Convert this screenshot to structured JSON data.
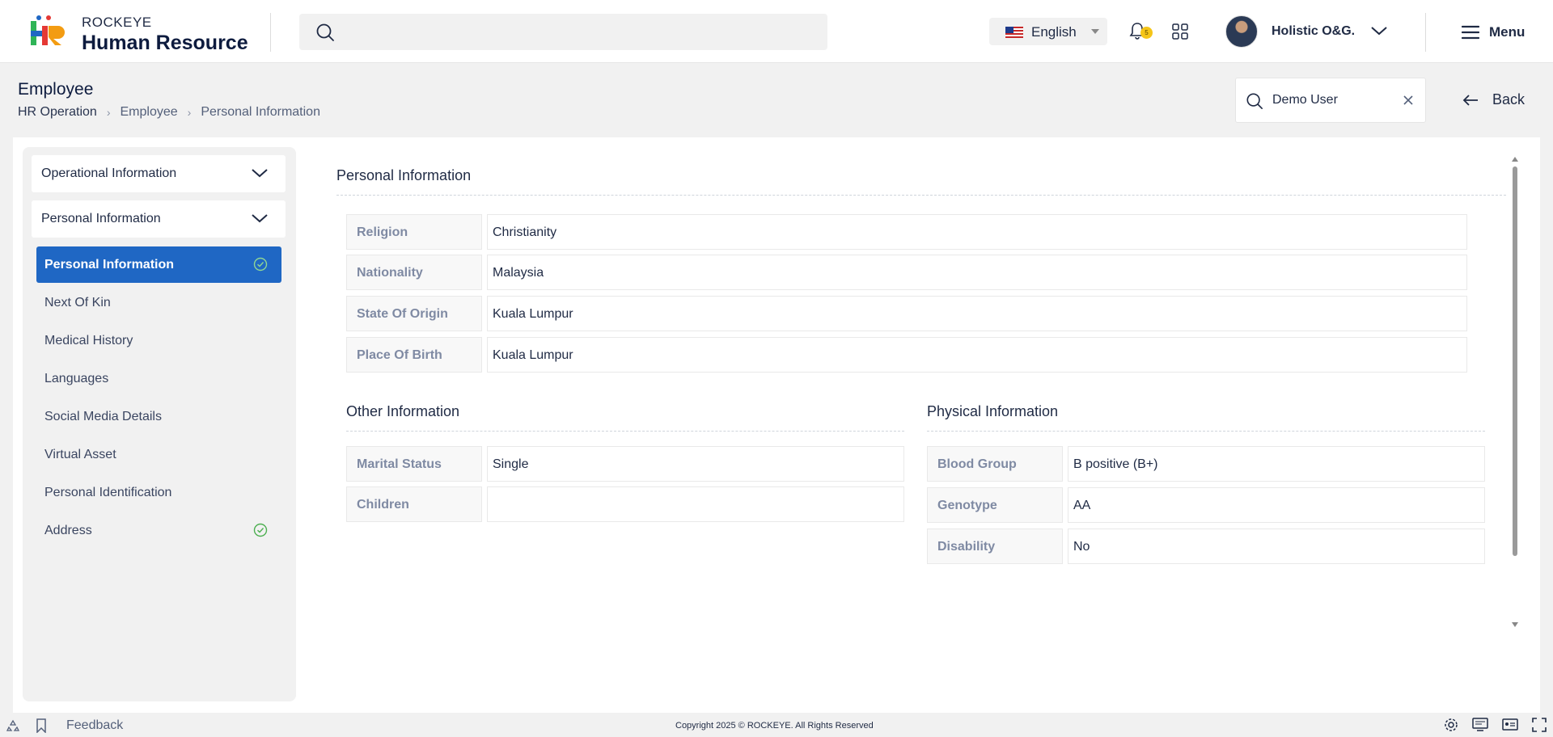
{
  "header": {
    "brand_top": "ROCKEYE",
    "brand_main": "Human Resource",
    "search_placeholder": "",
    "language": "English",
    "notification_count": "5",
    "user_name": "Holistic O&G.",
    "menu_label": "Menu"
  },
  "page": {
    "title": "Employee",
    "breadcrumb": [
      "HR Operation",
      "Employee",
      "Personal Information"
    ],
    "employee_search_value": "Demo User",
    "back_label": "Back"
  },
  "sidebar": {
    "accordions": [
      "Operational Information",
      "Personal Information"
    ],
    "items": [
      {
        "label": "Personal Information",
        "active": true,
        "completed": true
      },
      {
        "label": "Next Of Kin",
        "active": false,
        "completed": false
      },
      {
        "label": "Medical History",
        "active": false,
        "completed": false
      },
      {
        "label": "Languages",
        "active": false,
        "completed": false
      },
      {
        "label": "Social Media Details",
        "active": false,
        "completed": false
      },
      {
        "label": "Virtual Asset",
        "active": false,
        "completed": false
      },
      {
        "label": "Personal Identification",
        "active": false,
        "completed": false
      },
      {
        "label": "Address",
        "active": false,
        "completed": true
      }
    ]
  },
  "main": {
    "title": "Personal Information",
    "personal_fields": [
      {
        "label": "Religion",
        "value": "Christianity"
      },
      {
        "label": "Nationality",
        "value": "Malaysia"
      },
      {
        "label": "State Of Origin",
        "value": "Kuala Lumpur"
      },
      {
        "label": "Place Of Birth",
        "value": "Kuala Lumpur"
      }
    ],
    "other": {
      "title": "Other Information",
      "fields": [
        {
          "label": "Marital Status",
          "value": "Single"
        },
        {
          "label": "Children",
          "value": ""
        }
      ]
    },
    "physical": {
      "title": "Physical Information",
      "fields": [
        {
          "label": "Blood Group",
          "value": "B positive (B+)"
        },
        {
          "label": "Genotype",
          "value": "AA"
        },
        {
          "label": "Disability",
          "value": "No"
        }
      ]
    }
  },
  "footer": {
    "feedback": "Feedback",
    "copyright": "Copyright 2025 © ROCKEYE. All Rights Reserved"
  },
  "colors": {
    "accent": "#1f67c4",
    "check": "#4caf50",
    "badge": "#f5c518"
  }
}
